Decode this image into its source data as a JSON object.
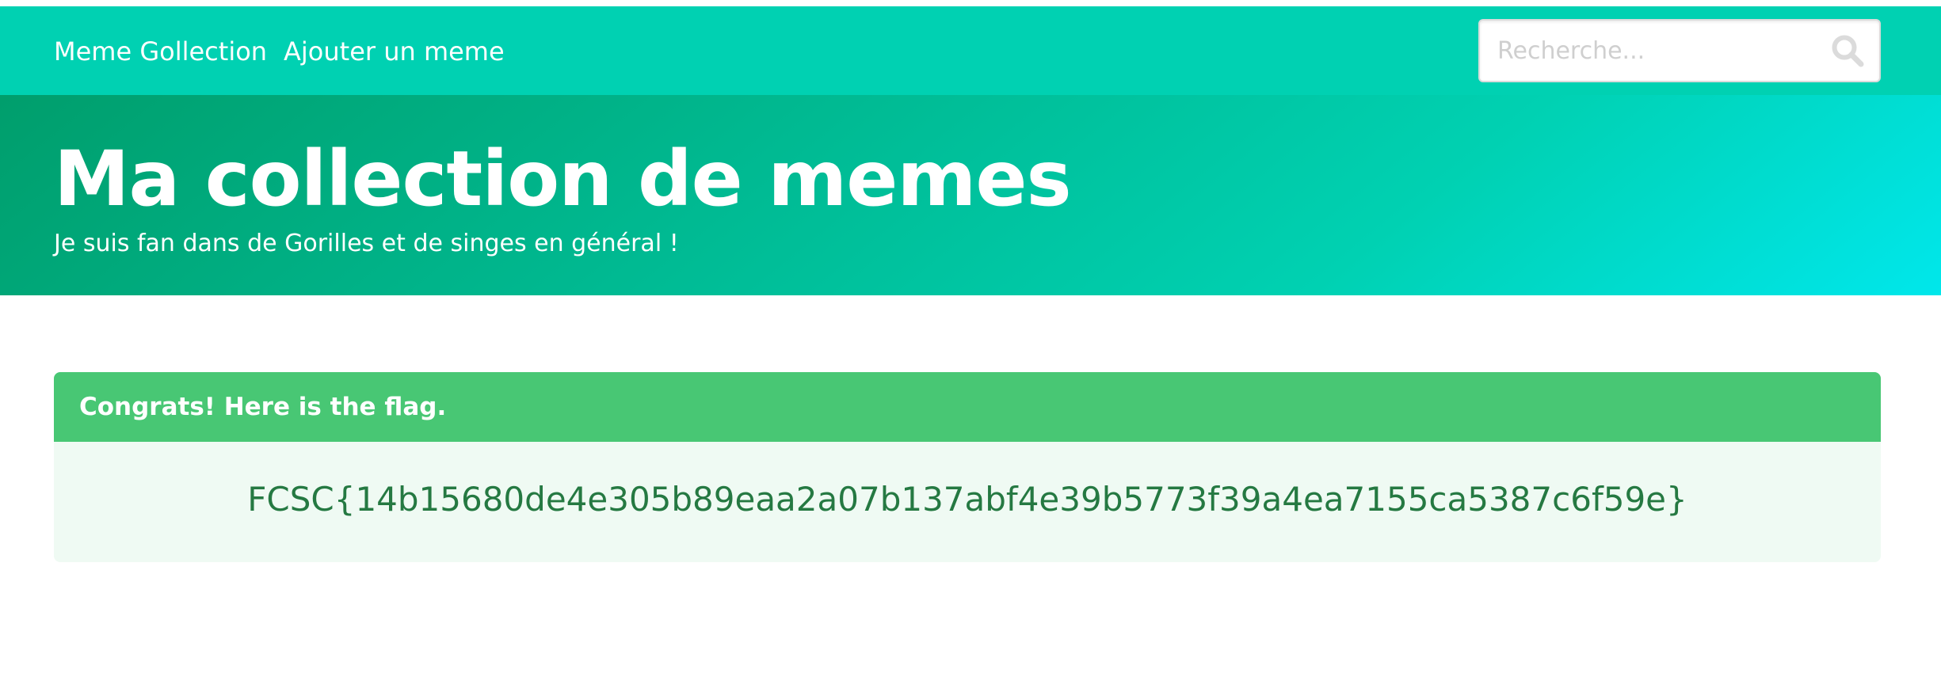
{
  "navbar": {
    "brand": "Meme Gollection",
    "add_link": "Ajouter un meme"
  },
  "search": {
    "placeholder": "Recherche...",
    "value": ""
  },
  "hero": {
    "title": "Ma collection de memes",
    "subtitle": "Je suis fan dans de Gorilles et de singes en général !"
  },
  "message": {
    "header": "Congrats! Here is the flag.",
    "body": "FCSC{14b15680de4e305b89eaa2a07b137abf4e39b5773f39a4ea7155ca5387c6f59e}"
  },
  "colors": {
    "navbar": "#00d1b2",
    "hero_gradient_start": "#009e6c",
    "hero_gradient_end": "#00e7eb",
    "success_header": "#48c774",
    "success_body_bg": "#effaf3",
    "success_text": "#257942"
  },
  "icons": {
    "search": "search-icon"
  }
}
